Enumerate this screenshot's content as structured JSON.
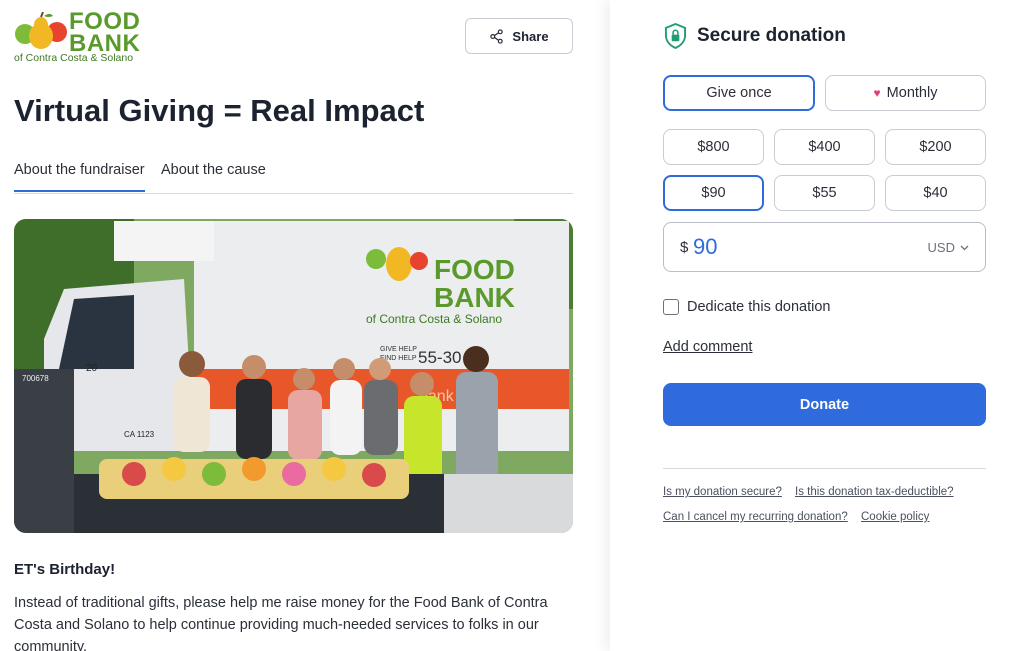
{
  "logo": {
    "word1": "FOOD",
    "word2": "BANK",
    "sub": "of Contra Costa & Solano",
    "color": "#5a9a2c"
  },
  "header": {
    "share_label": "Share",
    "share_icon": "share-icon"
  },
  "page": {
    "title": "Virtual Giving = Real Impact",
    "tabs": [
      {
        "label": "About the fundraiser",
        "active": true
      },
      {
        "label": "About the cause",
        "active": false
      }
    ],
    "photo": {
      "truck_logo_word1": "FOOD",
      "truck_logo_word2": "BANK",
      "truck_logo_sub": "of Contra Costa & Solano",
      "truck_phone": "55-30  63",
      "truck_tagline1": "GIVE HELP",
      "truck_tagline2": "FIND HELP",
      "truck_id": "20",
      "truck_plate": "CA 1123",
      "truck_tail": "bank",
      "truck_number": "700678"
    },
    "subtitle": "ET's Birthday!",
    "description": "Instead of traditional gifts, please help me raise money for the Food Bank of Contra Costa and Solano to help continue providing much-needed services to folks in our community."
  },
  "donation": {
    "heading": "Secure donation",
    "heading_icon": "shield-lock-icon",
    "frequency": [
      {
        "label": "Give once",
        "selected": true
      },
      {
        "label": "Monthly",
        "icon": "heart-icon",
        "selected": false
      }
    ],
    "amounts": [
      {
        "label": "$800",
        "selected": false
      },
      {
        "label": "$400",
        "selected": false
      },
      {
        "label": "$200",
        "selected": false
      },
      {
        "label": "$90",
        "selected": true
      },
      {
        "label": "$55",
        "selected": false
      },
      {
        "label": "$40",
        "selected": false
      }
    ],
    "currency_symbol": "$",
    "amount_value": "90",
    "currency_code": "USD",
    "dedicate_label": "Dedicate this donation",
    "dedicate_checked": false,
    "add_comment_label": "Add comment",
    "donate_label": "Donate",
    "faq": [
      "Is my donation secure?",
      "Is this donation tax-deductible?",
      "Can I cancel my recurring donation?",
      "Cookie policy"
    ],
    "accent_color": "#2f6bdc"
  }
}
